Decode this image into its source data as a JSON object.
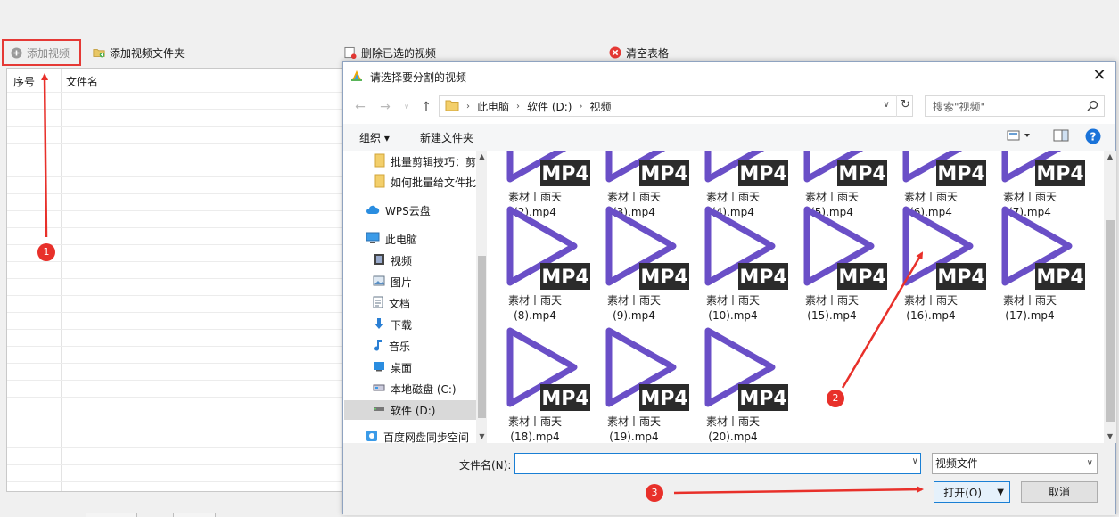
{
  "toolbar": {
    "add_video": "添加视频",
    "add_folder": "添加视频文件夹",
    "delete_selected": "删除已选的视频",
    "clear_table": "清空表格"
  },
  "table": {
    "col_index": "序号",
    "col_filename": "文件名"
  },
  "dialog": {
    "title": "请选择要分割的视频",
    "close": "✕",
    "breadcrumb": [
      "此电脑",
      "软件 (D:)",
      "视频"
    ],
    "search_placeholder": "搜索\"视频\"",
    "organize": "组织 ▾",
    "new_folder": "新建文件夹",
    "nav": [
      {
        "label": "批量剪辑技巧：剪"
      },
      {
        "label": "如何批量给文件批"
      },
      {
        "label": "WPS云盘"
      },
      {
        "label": "此电脑"
      },
      {
        "label": "视频"
      },
      {
        "label": "图片"
      },
      {
        "label": "文档"
      },
      {
        "label": "下载"
      },
      {
        "label": "音乐"
      },
      {
        "label": "桌面"
      },
      {
        "label": "本地磁盘 (C:)"
      },
      {
        "label": "软件 (D:)"
      },
      {
        "label": "百度网盘同步空间"
      }
    ],
    "mp4_badge": "MP4",
    "files": [
      {
        "line1": "素材丨雨天",
        "line2": "(2).mp4"
      },
      {
        "line1": "素材丨雨天",
        "line2": "(3).mp4"
      },
      {
        "line1": "素材丨雨天",
        "line2": "(4).mp4"
      },
      {
        "line1": "素材丨雨天",
        "line2": "(5).mp4"
      },
      {
        "line1": "素材丨雨天",
        "line2": "(6).mp4"
      },
      {
        "line1": "素材丨雨天",
        "line2": "(7).mp4"
      },
      {
        "line1": "素材丨雨天",
        "line2": "(8).mp4"
      },
      {
        "line1": "素材丨雨天",
        "line2": "(9).mp4"
      },
      {
        "line1": "素材丨雨天",
        "line2": "(10).mp4"
      },
      {
        "line1": "素材丨雨天",
        "line2": "(15).mp4"
      },
      {
        "line1": "素材丨雨天",
        "line2": "(16).mp4"
      },
      {
        "line1": "素材丨雨天",
        "line2": "(17).mp4"
      },
      {
        "line1": "素材丨雨天",
        "line2": "(18).mp4"
      },
      {
        "line1": "素材丨雨天",
        "line2": "(19).mp4"
      },
      {
        "line1": "素材丨雨天",
        "line2": "(20).mp4"
      }
    ],
    "filename_label": "文件名(N):",
    "filename_value": "",
    "filetype": "视频文件",
    "open": "打开(O)",
    "cancel": "取消"
  },
  "annotations": [
    "1",
    "2",
    "3"
  ],
  "colors": {
    "accent": "#1a7fd4",
    "play_icon": "#6a4fc7",
    "annotation": "#e8302a"
  }
}
